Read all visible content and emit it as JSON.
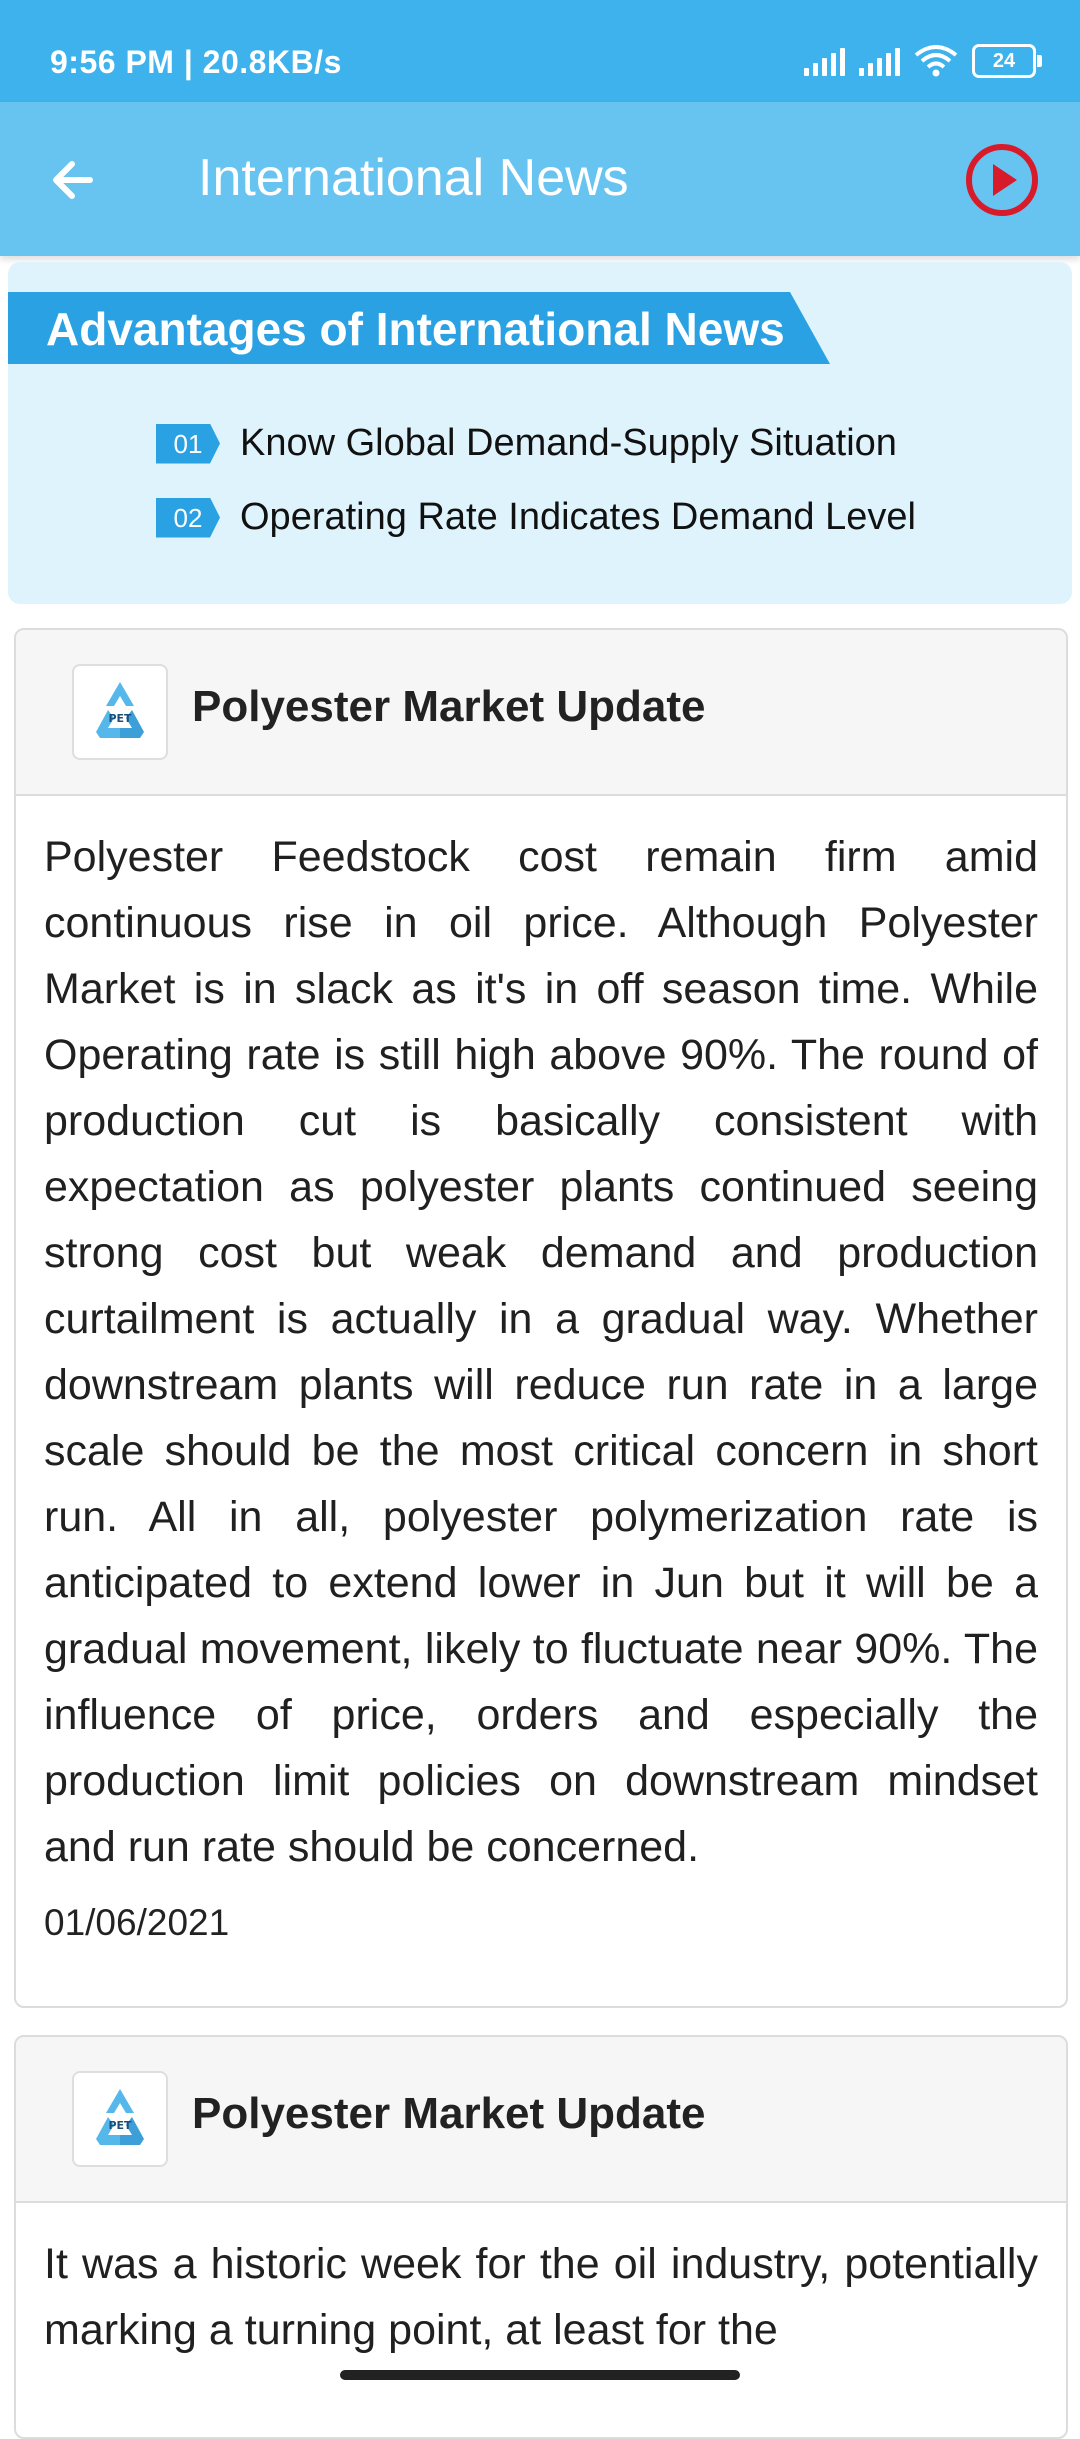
{
  "status_bar": {
    "time_speed": "9:56 PM | 20.8KB/s",
    "battery": "24"
  },
  "app_bar": {
    "title": "International News",
    "back_icon": "arrow-left-icon",
    "play_icon": "play-circle-icon"
  },
  "banner": {
    "heading": "Advantages of International News",
    "items": [
      {
        "num": "01",
        "text": "Know Global Demand-Supply Situation"
      },
      {
        "num": "02",
        "text": "Operating Rate Indicates Demand Level"
      }
    ]
  },
  "articles": [
    {
      "title": "Polyester Market Update",
      "logo_text": "PET",
      "body": "Polyester Feedstock cost remain firm amid continuous rise in oil price. Although Polyester Market is in slack as it's in off season time. While Operating rate is still high above 90%. The round of production cut is basically consistent with expectation as polyester plants continued seeing strong cost but weak demand and production curtailment is actually in a gradual way. Whether downstream plants will reduce run rate in a large scale should be the most critical concern in short run. All in all, polyester polymerization rate is anticipated to extend lower in Jun but it will be a gradual movement, likely to fluctuate near 90%. The influence of price, orders and especially the production limit policies on downstream mindset and run rate should be concerned.",
      "date": "01/06/2021"
    },
    {
      "title": "Polyester Market Update",
      "logo_text": "PET",
      "body": "It was a historic week for the oil industry, potentially marking a turning point, at least for the"
    }
  ],
  "colors": {
    "status_bar": "#3db2ec",
    "app_bar": "#67c3f0",
    "banner_bg": "#dff3fd",
    "ribbon": "#2aa1e3",
    "play_icon": "#d81b2a"
  }
}
